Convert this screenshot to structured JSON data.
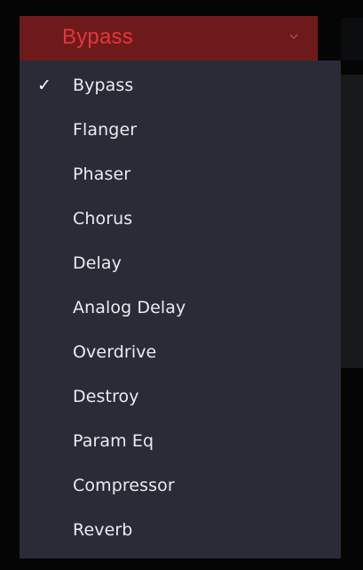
{
  "effect_dropdown": {
    "selected_value": "Bypass",
    "accent_color": "#e0383b",
    "header_color": "#6e1a1a",
    "menu_color": "#292c36",
    "expand_icon": "chevron-down-icon",
    "check_mark": "✓",
    "items": [
      {
        "label": "Bypass",
        "selected": true
      },
      {
        "label": "Flanger",
        "selected": false
      },
      {
        "label": "Phaser",
        "selected": false
      },
      {
        "label": "Chorus",
        "selected": false
      },
      {
        "label": "Delay",
        "selected": false
      },
      {
        "label": "Analog Delay",
        "selected": false
      },
      {
        "label": "Overdrive",
        "selected": false
      },
      {
        "label": "Destroy",
        "selected": false
      },
      {
        "label": "Param Eq",
        "selected": false
      },
      {
        "label": "Compressor",
        "selected": false
      },
      {
        "label": "Reverb",
        "selected": false
      }
    ]
  }
}
